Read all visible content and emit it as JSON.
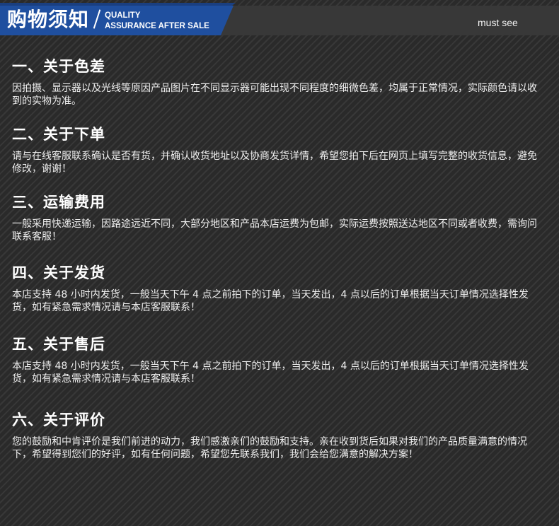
{
  "header": {
    "title": "购物须知",
    "subtitle_line1": "QUALITY",
    "subtitle_line2": "ASSURANCE AFTER SALE",
    "tag": "must see"
  },
  "sections": [
    {
      "heading": "一、关于色差",
      "body": "因拍摄、显示器以及光线等原因产品图片在不同显示器可能出现不同程度的细微色差，均属于正常情况，实际颜色请以收到的实物为准。"
    },
    {
      "heading": "二、关于下单",
      "body": "请与在线客服联系确认是否有货，并确认收货地址以及协商发货详情，希望您拍下后在网页上填写完整的收货信息，避免修改，谢谢！"
    },
    {
      "heading": "三、运输费用",
      "body": "一般采用快递运输，因路途远近不同，大部分地区和产品本店运费为包邮，实际运费按照送达地区不同或者收费，需询问联系客服！"
    },
    {
      "heading": "四、关于发货",
      "body": "本店支持 48 小时内发货，一般当天下午 4 点之前拍下的订单，当天发出，4 点以后的订单根据当天订单情况选择性发货，如有紧急需求情况请与本店客服联系！"
    },
    {
      "heading": "五、关于售后",
      "body": "本店支持 48 小时内发货，一般当天下午 4 点之前拍下的订单，当天发出，4 点以后的订单根据当天订单情况选择性发货，如有紧急需求情况请与本店客服联系！"
    },
    {
      "heading": "六、关于评价",
      "body": "您的鼓励和中肯评价是我们前进的动力，我们感激亲们的鼓励和支持。亲在收到货后如果对我们的产品质量满意的情况下，希望得到您们的好评，如有任何问题，希望您先联系我们，我们会给您满意的解决方案！"
    }
  ]
}
